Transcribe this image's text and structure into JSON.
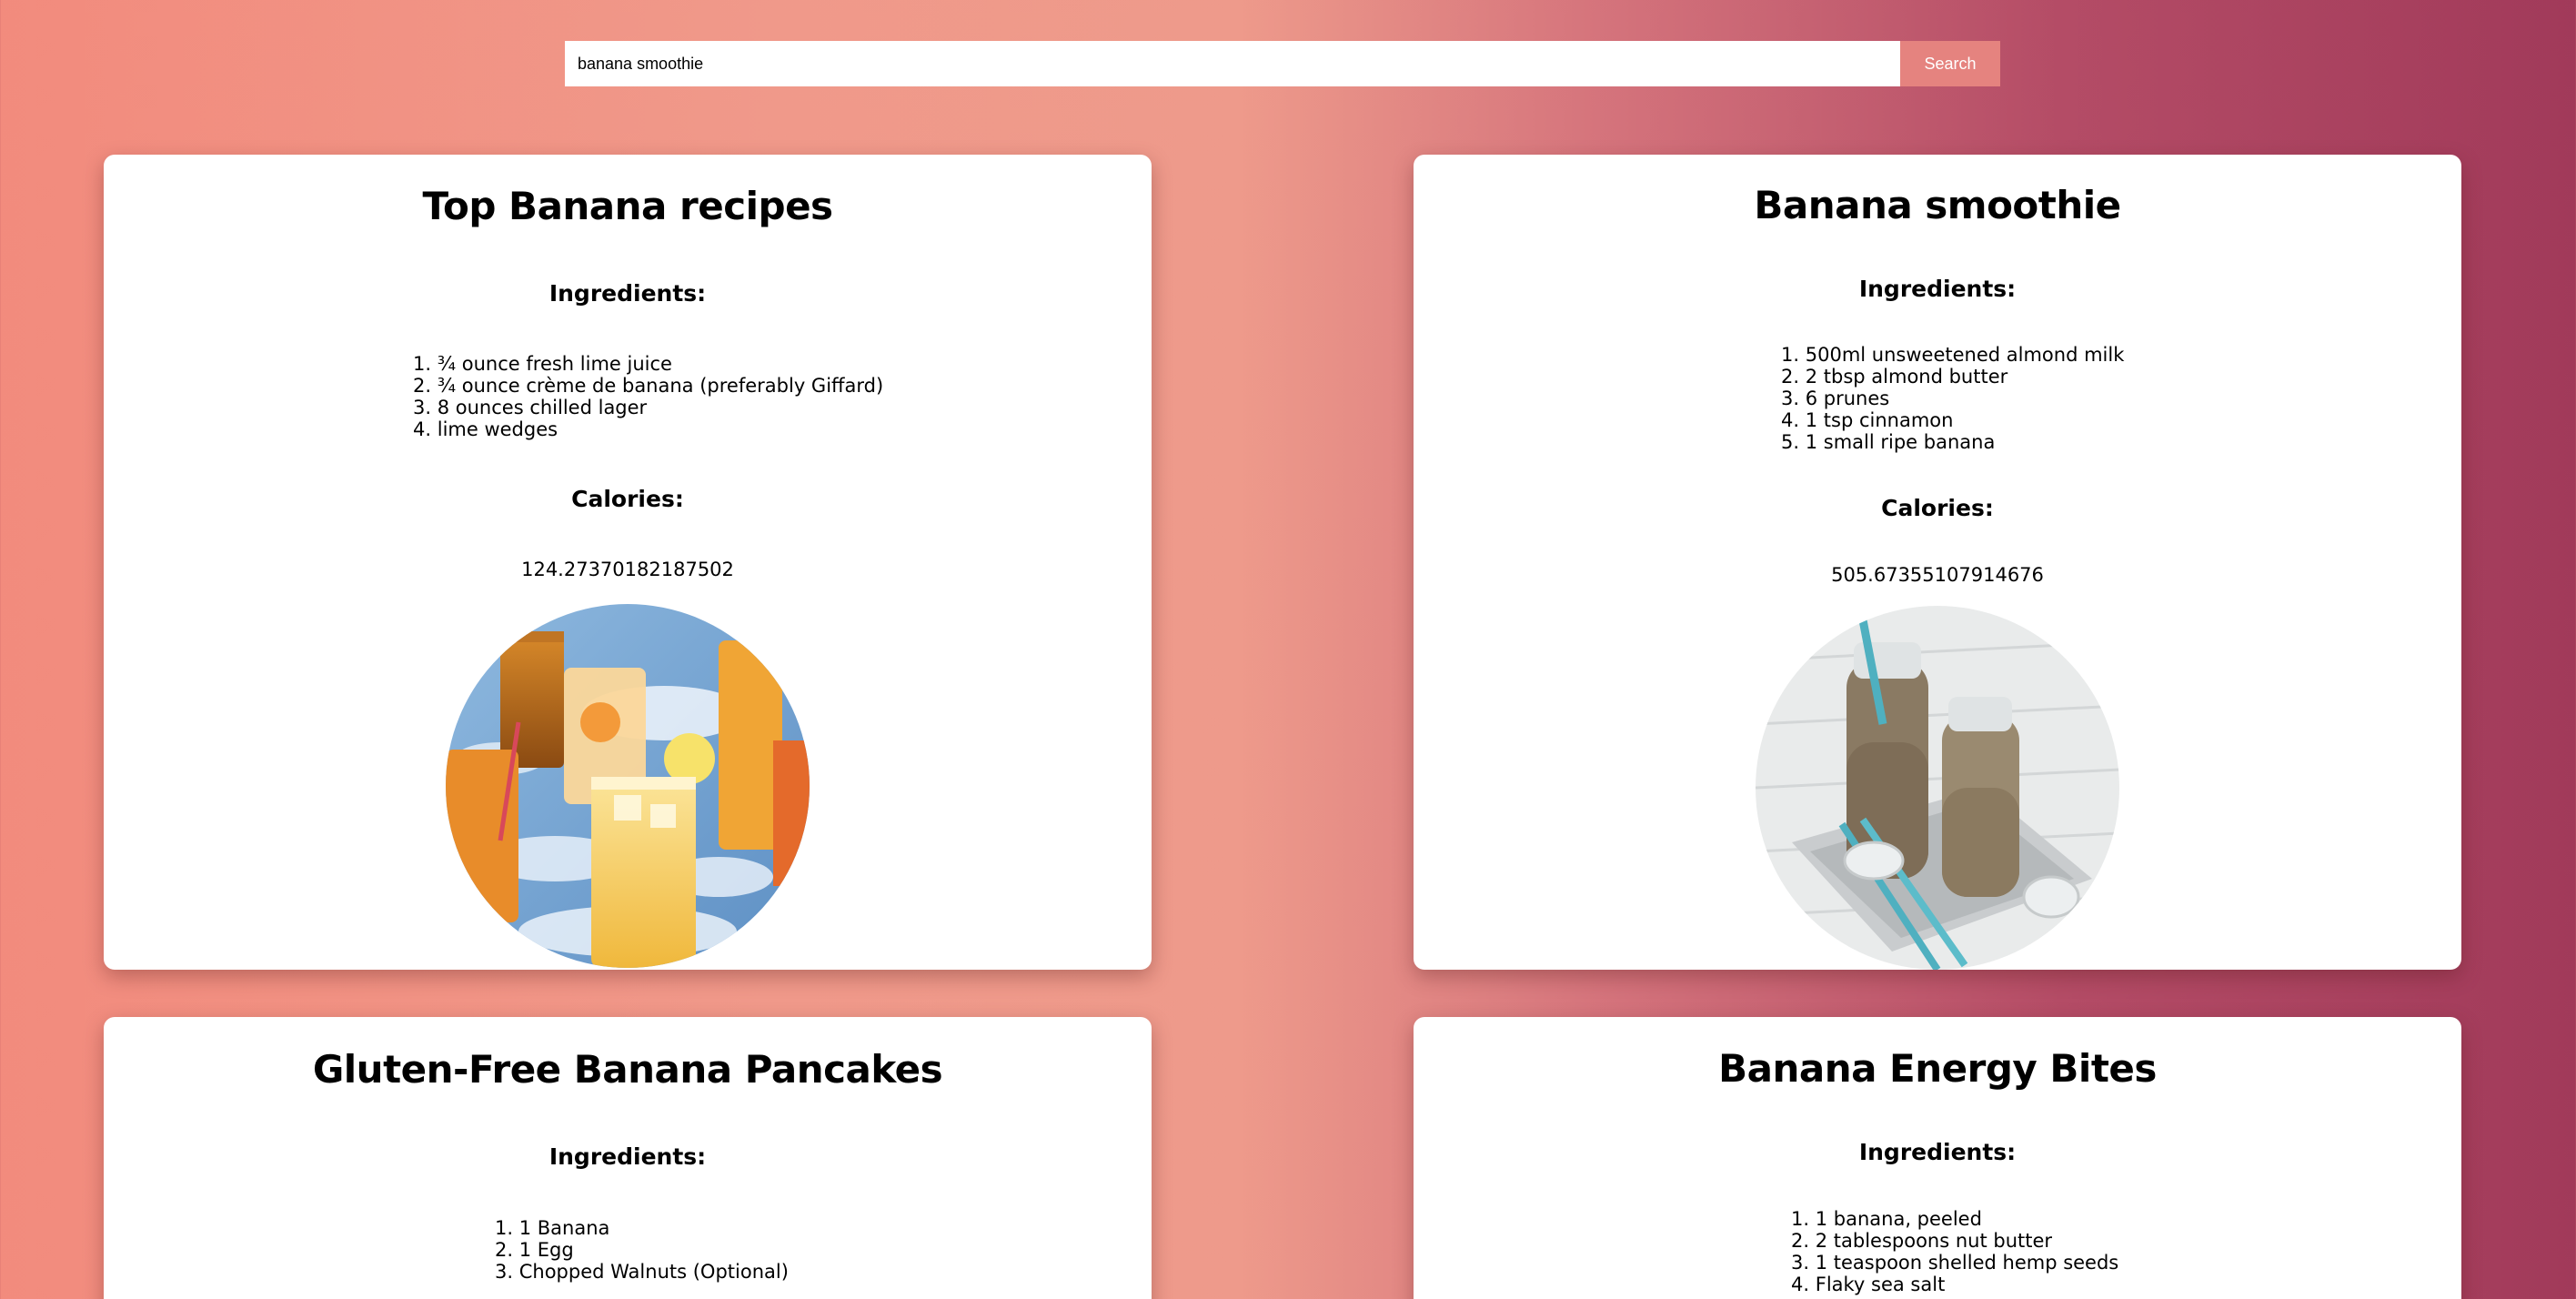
{
  "search": {
    "value": "banana smoothie",
    "button_label": "Search"
  },
  "labels": {
    "ingredients": "Ingredients:",
    "calories": "Calories:"
  },
  "recipes": [
    {
      "title": "Top Banana recipes",
      "ingredients": [
        "¾ ounce fresh lime juice",
        "¾ ounce crème de banana (preferably Giffard)",
        "8 ounces chilled lager",
        "lime wedges"
      ],
      "calories": "124.27370182187502",
      "image": "iced-drinks-photo"
    },
    {
      "title": "Banana smoothie",
      "ingredients": [
        "500ml unsweetened almond milk",
        "2 tbsp almond butter",
        "6 prunes",
        "1 tsp cinnamon",
        "1 small ripe banana"
      ],
      "calories": "505.67355107914676",
      "image": "smoothie-bottles-photo"
    },
    {
      "title": "Gluten-Free Banana Pancakes",
      "ingredients": [
        "1 Banana",
        "1 Egg",
        "Chopped Walnuts (Optional)"
      ]
    },
    {
      "title": "Banana Energy Bites",
      "ingredients": [
        "1 banana, peeled",
        "2 tablespoons nut butter",
        "1 teaspoon shelled hemp seeds",
        "Flaky sea salt"
      ]
    }
  ]
}
